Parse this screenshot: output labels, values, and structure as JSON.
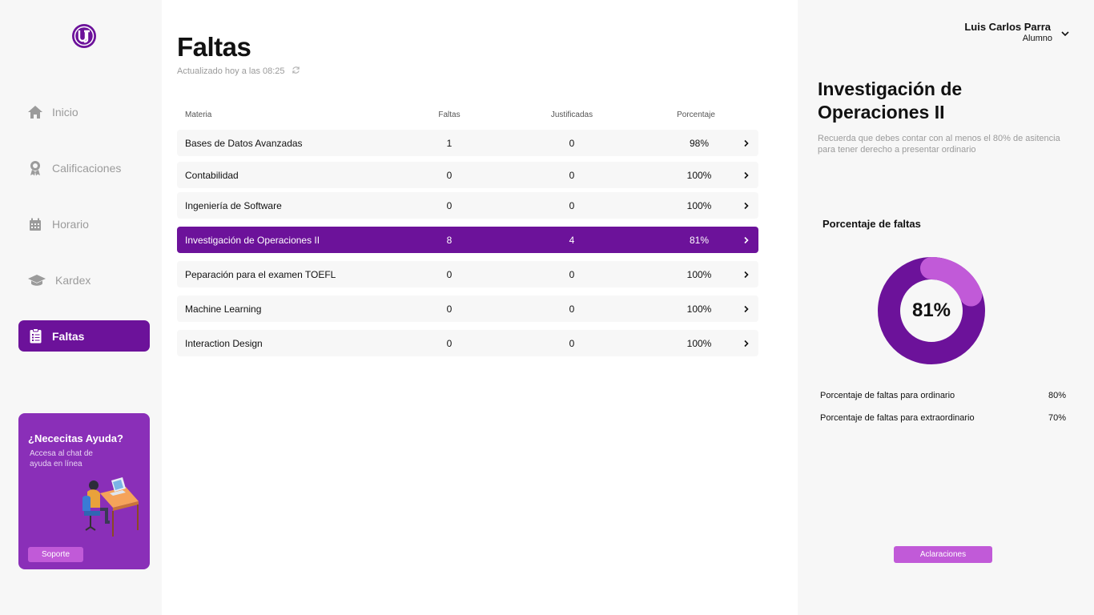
{
  "sidebar": {
    "nav": [
      {
        "label": "Inicio",
        "icon": "home-icon"
      },
      {
        "label": "Calificaciones",
        "icon": "award-icon"
      },
      {
        "label": "Horario",
        "icon": "calendar-icon"
      },
      {
        "label": "Kardex",
        "icon": "graduation-cap-icon"
      },
      {
        "label": "Faltas",
        "icon": "clipboard-icon",
        "active": true
      }
    ],
    "help": {
      "title": "¿Nececitas Ayuda?",
      "text": "Accesa al chat de ayuda en línea",
      "button": "Soporte"
    }
  },
  "main": {
    "title": "Faltas",
    "updated": "Actualizado hoy a las 08:25",
    "columns": {
      "materia": "Materia",
      "faltas": "Faltas",
      "justificadas": "Justificadas",
      "porcentaje": "Porcentaje"
    },
    "rows": [
      {
        "materia": "Bases de Datos Avanzadas",
        "faltas": "1",
        "justificadas": "0",
        "porcentaje": "98%"
      },
      {
        "materia": "Contabilidad",
        "faltas": "0",
        "justificadas": "0",
        "porcentaje": "100%"
      },
      {
        "materia": "Ingeniería de Software",
        "faltas": "0",
        "justificadas": "0",
        "porcentaje": "100%"
      },
      {
        "materia": "Investigación de Operaciones II",
        "faltas": "8",
        "justificadas": "4",
        "porcentaje": "81%"
      },
      {
        "materia": "Peparación para el examen TOEFL",
        "faltas": "0",
        "justificadas": "0",
        "porcentaje": "100%"
      },
      {
        "materia": "Machine Learning",
        "faltas": "0",
        "justificadas": "0",
        "porcentaje": "100%"
      },
      {
        "materia": "Interaction Design",
        "faltas": "0",
        "justificadas": "0",
        "porcentaje": "100%"
      }
    ]
  },
  "user": {
    "name": "Luis Carlos Parra",
    "role": "Alumno"
  },
  "detail": {
    "subject": "Investigación de Operaciones II",
    "note": "Recuerda que debes contar con al menos el 80% de asitencia para tener derecho a presentar ordinario",
    "chart_label": "Porcentaje de faltas",
    "percent_value": 81,
    "percent_text": "81%",
    "stats": [
      {
        "label": "Porcentaje de faltas para ordinario",
        "value": "80%"
      },
      {
        "label": "Porcentaje de faltas para extraordinario",
        "value": "70%"
      }
    ],
    "button": "Aclaraciones"
  },
  "colors": {
    "primary": "#6c129a",
    "accent": "#c15ad8",
    "card": "#8a2fb8"
  }
}
